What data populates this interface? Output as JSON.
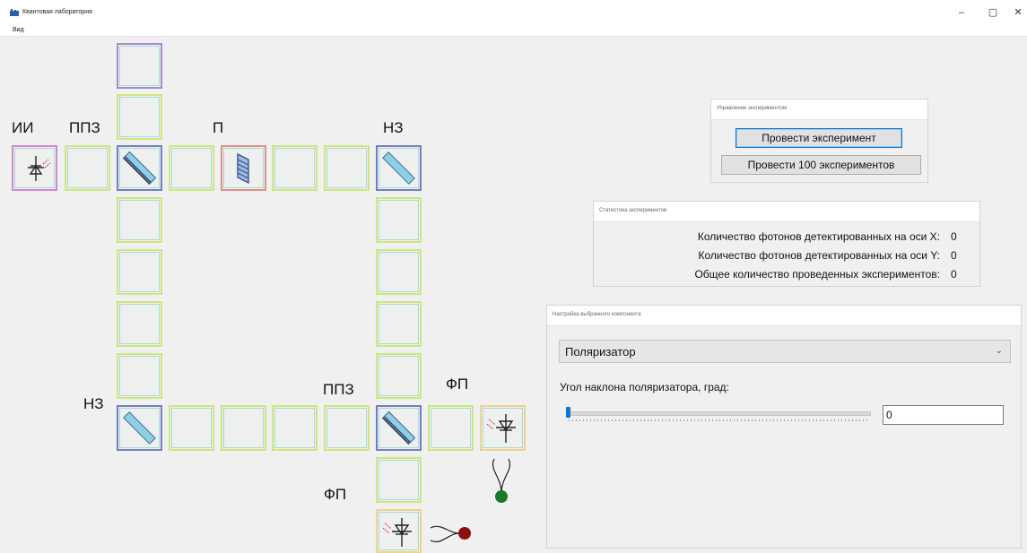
{
  "window": {
    "title": "Квантовая лаборатория",
    "controls": {
      "minimize": "–",
      "maximize": "▢",
      "close": "✕"
    }
  },
  "menu": {
    "items": [
      {
        "label": "Вид"
      }
    ]
  },
  "lab": {
    "labels": {
      "source": "ИИ",
      "ppz_top": "ППЗ",
      "polarizer": "П",
      "nz_top": "НЗ",
      "nz_bottom": "НЗ",
      "ppz_bottom": "ППЗ",
      "detector_right": "ФП",
      "detector_bottom": "ФП"
    },
    "colors": {
      "cell_border": "#cfe77a",
      "cell_inner": "#a9d9d6",
      "mirror": "#8ecfe6",
      "detector_x_lamp": "#1a7a2a",
      "detector_y_lamp": "#8a1010"
    },
    "icons": {
      "source": "photon-source-icon",
      "beam_splitter": "beam-splitter-icon",
      "mirror": "mirror-icon",
      "polarizer": "polarizer-icon",
      "detector": "photodetector-icon"
    }
  },
  "control_panel": {
    "title": "Управление экспериментом",
    "run_once": "Провести эксперимент",
    "run_hundred": "Провести 100 экспериментов"
  },
  "stats_panel": {
    "title": "Статистика экспериментов",
    "rows": [
      {
        "label": "Количество фотонов детектированных на оси X:",
        "value": "0"
      },
      {
        "label": "Количество фотонов детектированных на оси Y:",
        "value": "0"
      },
      {
        "label": "Общее количество проведенных экспериментов:",
        "value": "0"
      }
    ]
  },
  "settings_panel": {
    "title": "Настройка выбранного компонента",
    "component_select": "Поляризатор",
    "angle_label": "Угол наклона поляризатора, град:",
    "angle_value": "0",
    "slider_value": 0
  }
}
